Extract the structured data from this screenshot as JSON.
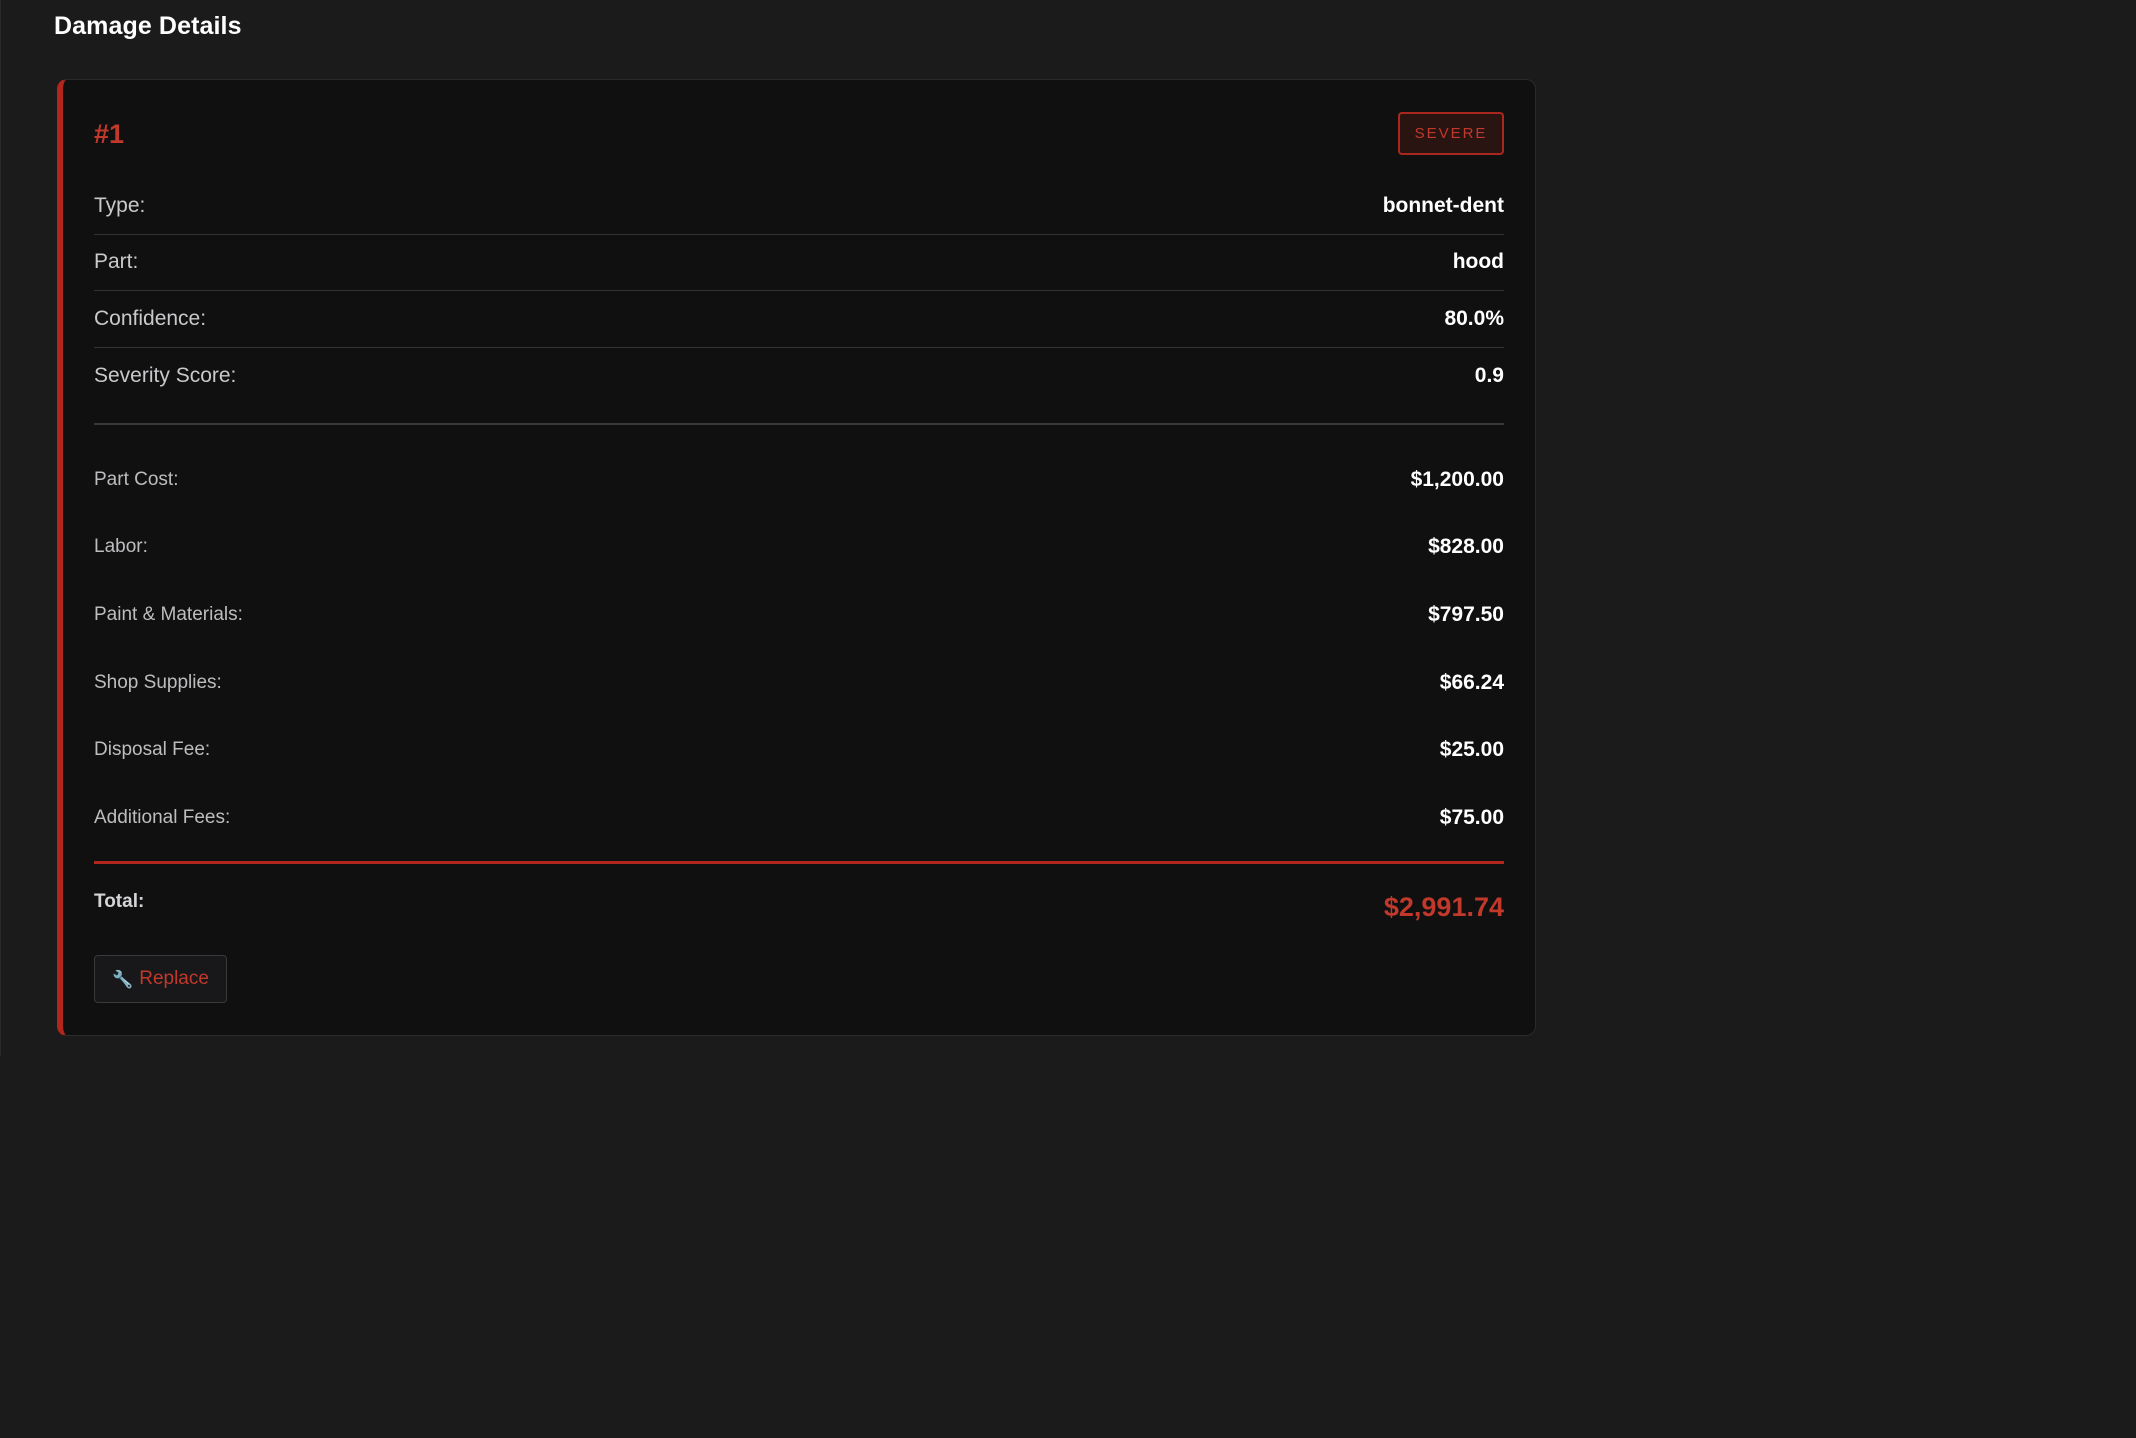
{
  "section": {
    "title": "Damage Details"
  },
  "damage": {
    "index": "#1",
    "severity": "SEVERE",
    "details": [
      {
        "label": "Type:",
        "value": "bonnet-dent"
      },
      {
        "label": "Part:",
        "value": "hood"
      },
      {
        "label": "Confidence:",
        "value": "80.0%"
      },
      {
        "label": "Severity Score:",
        "value": "0.9"
      }
    ],
    "costs": [
      {
        "label": "Part Cost:",
        "value": "$1,200.00"
      },
      {
        "label": "Labor:",
        "value": "$828.00"
      },
      {
        "label": "Paint & Materials:",
        "value": "$797.50"
      },
      {
        "label": "Shop Supplies:",
        "value": "$66.24"
      },
      {
        "label": "Disposal Fee:",
        "value": "$25.00"
      },
      {
        "label": "Additional Fees:",
        "value": "$75.00"
      }
    ],
    "total_label": "Total:",
    "total_value": "$2,991.74",
    "action": {
      "icon": "wrench-icon",
      "label": "Replace"
    }
  },
  "colors": {
    "accent": "#c0392b",
    "card_border_accent": "#b3261e",
    "background": "#1b1b1c",
    "card_background": "#101011"
  }
}
